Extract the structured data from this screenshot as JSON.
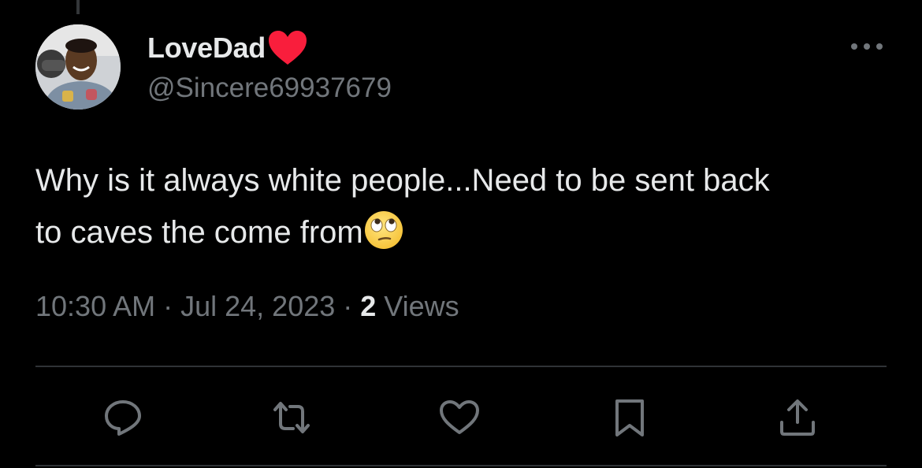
{
  "tweet": {
    "author": {
      "display_name": "LoveDad",
      "name_emoji": "red-heart-icon",
      "handle": "@Sincere69937679"
    },
    "text_line1": "Why is it always white people...Need to be sent back",
    "text_line2": "to caves the come from",
    "text_emoji": "face-with-rolling-eyes-icon",
    "meta": {
      "time": "10:30 AM",
      "separator": " · ",
      "date": "Jul 24, 2023",
      "views_count": "2",
      "views_label": " Views"
    }
  },
  "actions": [
    {
      "name": "reply",
      "icon": "reply-icon"
    },
    {
      "name": "repost",
      "icon": "repost-icon"
    },
    {
      "name": "like",
      "icon": "heart-outline-icon"
    },
    {
      "name": "bookmark",
      "icon": "bookmark-icon"
    },
    {
      "name": "share",
      "icon": "share-icon"
    }
  ],
  "colors": {
    "background": "#000000",
    "primary_text": "#e7e9ea",
    "secondary_text": "#71767b",
    "divider": "#2f3336",
    "heart": "#f91e3c"
  }
}
